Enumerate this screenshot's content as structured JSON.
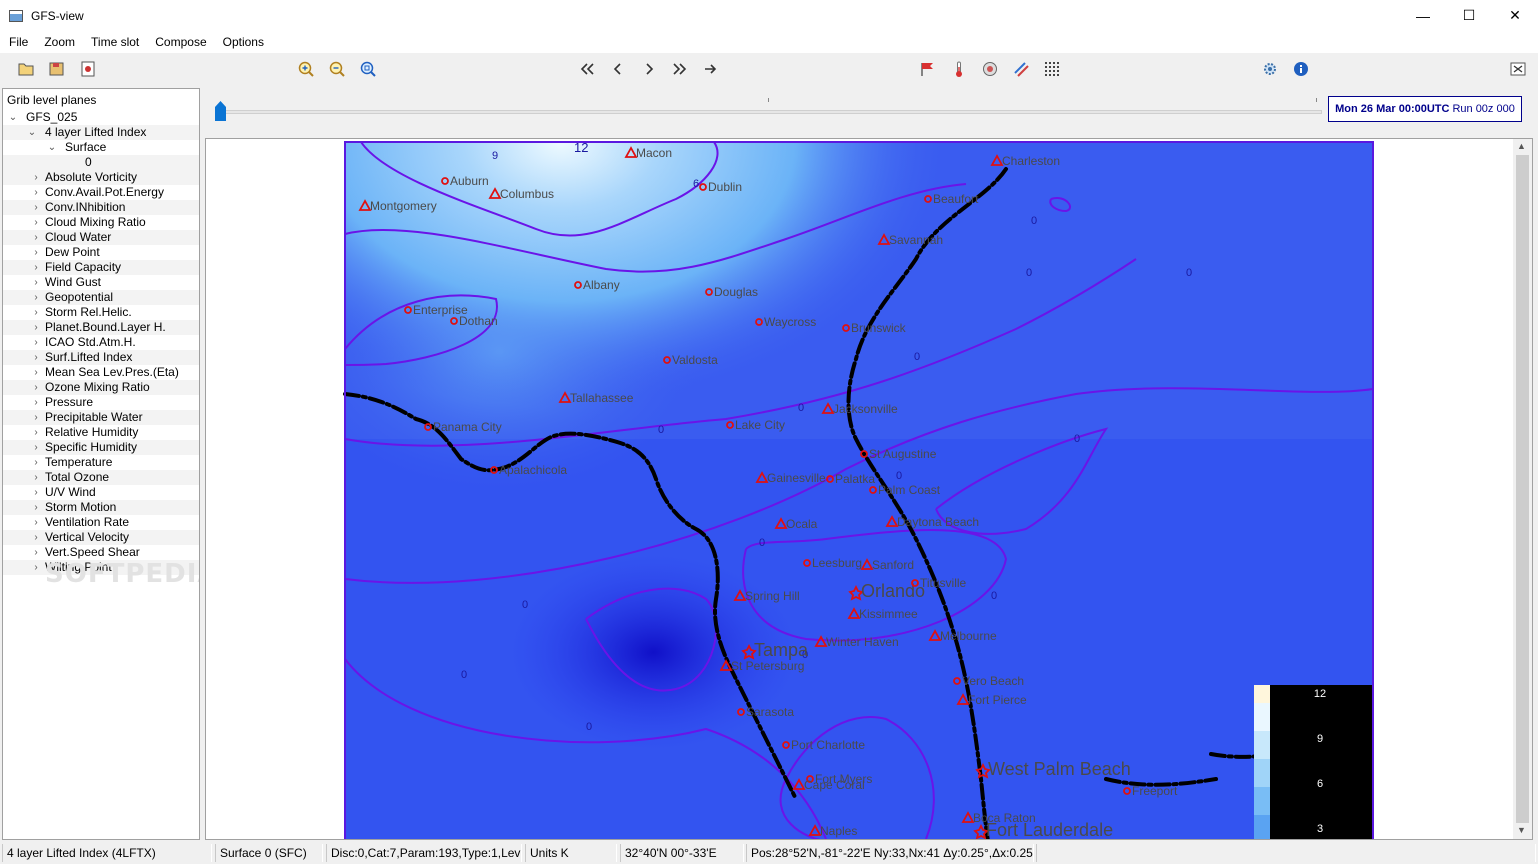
{
  "window": {
    "title": "GFS-view"
  },
  "menu": [
    "File",
    "Zoom",
    "Time slot",
    "Compose",
    "Options"
  ],
  "toolbar": {
    "icons": [
      "open-file-icon",
      "save-icon",
      "settings-file-icon",
      "zoom-in-icon",
      "zoom-out-icon",
      "zoom-fit-icon",
      "first-icon",
      "previous-icon",
      "next-icon",
      "last-icon",
      "animate-icon",
      "wind-flag-icon",
      "thermometer-icon",
      "pressure-icon",
      "gust-icon",
      "grid-icon",
      "preferences-icon",
      "info-icon",
      "close-panel-icon"
    ]
  },
  "tree": {
    "title": "Grib level planes",
    "root": "GFS_025",
    "selected_param": "4 layer Lifted Index",
    "selected_level": "Surface",
    "selected_value": "0",
    "params": [
      "Absolute Vorticity",
      "Conv.Avail.Pot.Energy",
      "Conv.INhibition",
      "Cloud Mixing Ratio",
      "Cloud Water",
      "Dew Point",
      "Field Capacity",
      "Wind Gust",
      "Geopotential",
      "Storm Rel.Helic.",
      "Planet.Bound.Layer H.",
      "ICAO Std.Atm.H.",
      "Surf.Lifted Index",
      "Mean Sea Lev.Pres.(Eta)",
      "Ozone Mixing Ratio",
      "Pressure",
      "Precipitable Water",
      "Relative Humidity",
      "Specific Humidity",
      "Temperature",
      "Total Ozone",
      "U/V Wind",
      "Storm Motion",
      "Ventilation Rate",
      "Vertical Velocity",
      "Vert.Speed Shear",
      "Wilting Point"
    ],
    "watermark": "SOFTPEDIA"
  },
  "timeline": {
    "date": "Mon 26 Mar 00:00UTC",
    "run": "Run 00z 000"
  },
  "map": {
    "cities": [
      {
        "name": "Macon",
        "type": "triangle"
      },
      {
        "name": "Auburn",
        "type": "circle"
      },
      {
        "name": "Columbus",
        "type": "triangle"
      },
      {
        "name": "Dublin",
        "type": "circle"
      },
      {
        "name": "Montgomery",
        "type": "triangle"
      },
      {
        "name": "Charleston",
        "type": "triangle"
      },
      {
        "name": "Beaufort",
        "type": "circle"
      },
      {
        "name": "Savannah",
        "type": "triangle"
      },
      {
        "name": "Albany",
        "type": "circle"
      },
      {
        "name": "Douglas",
        "type": "circle"
      },
      {
        "name": "Enterprise",
        "type": "circle"
      },
      {
        "name": "Dothan",
        "type": "circle"
      },
      {
        "name": "Waycross",
        "type": "circle"
      },
      {
        "name": "Brunswick",
        "type": "circle"
      },
      {
        "name": "Valdosta",
        "type": "circle"
      },
      {
        "name": "Tallahassee",
        "type": "triangle"
      },
      {
        "name": "Lake City",
        "type": "circle"
      },
      {
        "name": "Jacksonville",
        "type": "triangle"
      },
      {
        "name": "Panama City",
        "type": "circle"
      },
      {
        "name": "St Augustine",
        "type": "circle"
      },
      {
        "name": "Apalachicola",
        "type": "circle"
      },
      {
        "name": "Gainesville",
        "type": "triangle"
      },
      {
        "name": "Palatka",
        "type": "circle"
      },
      {
        "name": "Palm Coast",
        "type": "circle"
      },
      {
        "name": "Ocala",
        "type": "triangle"
      },
      {
        "name": "Daytona Beach",
        "type": "triangle"
      },
      {
        "name": "Leesburg",
        "type": "circle"
      },
      {
        "name": "Sanford",
        "type": "triangle"
      },
      {
        "name": "Orlando",
        "type": "star"
      },
      {
        "name": "Titusville",
        "type": "circle"
      },
      {
        "name": "Spring Hill",
        "type": "triangle"
      },
      {
        "name": "Kissimmee",
        "type": "triangle"
      },
      {
        "name": "Tampa",
        "type": "star"
      },
      {
        "name": "Winter Haven",
        "type": "triangle"
      },
      {
        "name": "Melbourne",
        "type": "triangle"
      },
      {
        "name": "St Petersburg",
        "type": "triangle"
      },
      {
        "name": "Vero Beach",
        "type": "circle"
      },
      {
        "name": "Fort Pierce",
        "type": "triangle"
      },
      {
        "name": "Sarasota",
        "type": "circle"
      },
      {
        "name": "Port Charlotte",
        "type": "circle"
      },
      {
        "name": "West Palm Beach",
        "type": "star"
      },
      {
        "name": "Fort Myers",
        "type": "circle"
      },
      {
        "name": "Cape Coral",
        "type": "triangle"
      },
      {
        "name": "Freeport",
        "type": "circle"
      },
      {
        "name": "Boca Raton",
        "type": "triangle"
      },
      {
        "name": "Fort Lauderdale",
        "type": "star"
      },
      {
        "name": "Naples",
        "type": "triangle"
      }
    ],
    "contour_labels": [
      "12",
      "9",
      "6",
      "0",
      "0",
      "0",
      "0",
      "0",
      "0",
      "0",
      "0",
      "0",
      "0",
      "0",
      "0",
      "0",
      "0"
    ],
    "legend": [
      "12",
      "9",
      "6",
      "3"
    ],
    "colors": {
      "ocean": "#3a5cf0",
      "contour": "#6a14e8",
      "coast": "#000000",
      "marker": "#e01010"
    }
  },
  "status": {
    "param": "4 layer Lifted Index (4LFTX)",
    "level": "Surface 0 (SFC)",
    "codes": "Disc:0,Cat:7,Param:193,Type:1,Lev:0",
    "units": "Units K",
    "cursor": "32°40'N  00°-33'E",
    "pos": "Pos:28°52'N,-81°-22'E  Ny:33,Nx:41  Δy:0.25°,Δx:0.25°"
  }
}
